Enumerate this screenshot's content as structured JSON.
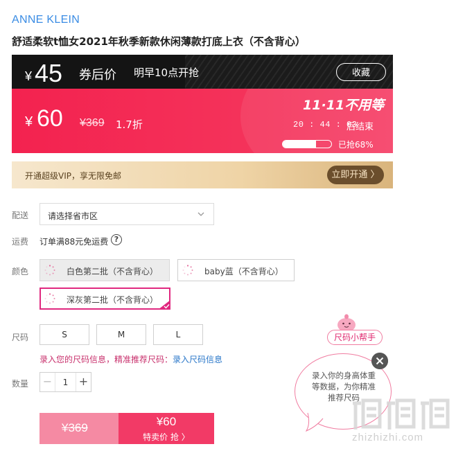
{
  "product": {
    "brand": "ANNE KLEIN",
    "title": "舒适柔软t恤女2021年秋季新款休闲薄款打底上衣（不含背心）"
  },
  "promo": {
    "currency": "¥",
    "coupon_price": "45",
    "coupon_label": "券后价",
    "coupon_time": "明早10点开抢",
    "favorite_label": "收藏",
    "price": "60",
    "original_price": "¥369",
    "discount": "1.7折",
    "event": "11·11不用等",
    "countdown": "20 : 44 : 03",
    "countdown_label": "后结束",
    "sold_percent": 68,
    "sold_label": "已抢68%"
  },
  "vip": {
    "text": "开通超级VIP，享无限免邮",
    "button": "立即开通 〉"
  },
  "delivery": {
    "label": "配送",
    "placeholder": "请选择省市区",
    "shipping_label": "运费",
    "shipping_text": "订单满88元免运费"
  },
  "color": {
    "label": "颜色",
    "options": [
      {
        "name": "白色第二批（不含背心）",
        "state": "disabled"
      },
      {
        "name": "baby蓝（不含背心）",
        "state": "normal"
      },
      {
        "name": "深灰第二批（不含背心）",
        "state": "selected"
      }
    ]
  },
  "size": {
    "label": "尺码",
    "options": [
      "S",
      "M",
      "L"
    ],
    "hint": "录入您的尺码信息，精准推荐尺码：",
    "link": "录入尺码信息"
  },
  "quantity": {
    "label": "数量",
    "value": "1",
    "minus": "−",
    "plus": "+"
  },
  "buy": {
    "original_price": "¥369",
    "price": "¥60",
    "label": "特卖价 抢 〉"
  },
  "size_assistant": {
    "button": "尺码小帮手",
    "bubble": "录入你的身高体重等数据，为你精准推荐尺码"
  },
  "watermark": {
    "sub": "zhizhizhi.com"
  },
  "colors": {
    "accent": "#f23a66",
    "link": "#2a77c9",
    "brand": "#3a8ce4",
    "vip": "#6b4e2c"
  }
}
